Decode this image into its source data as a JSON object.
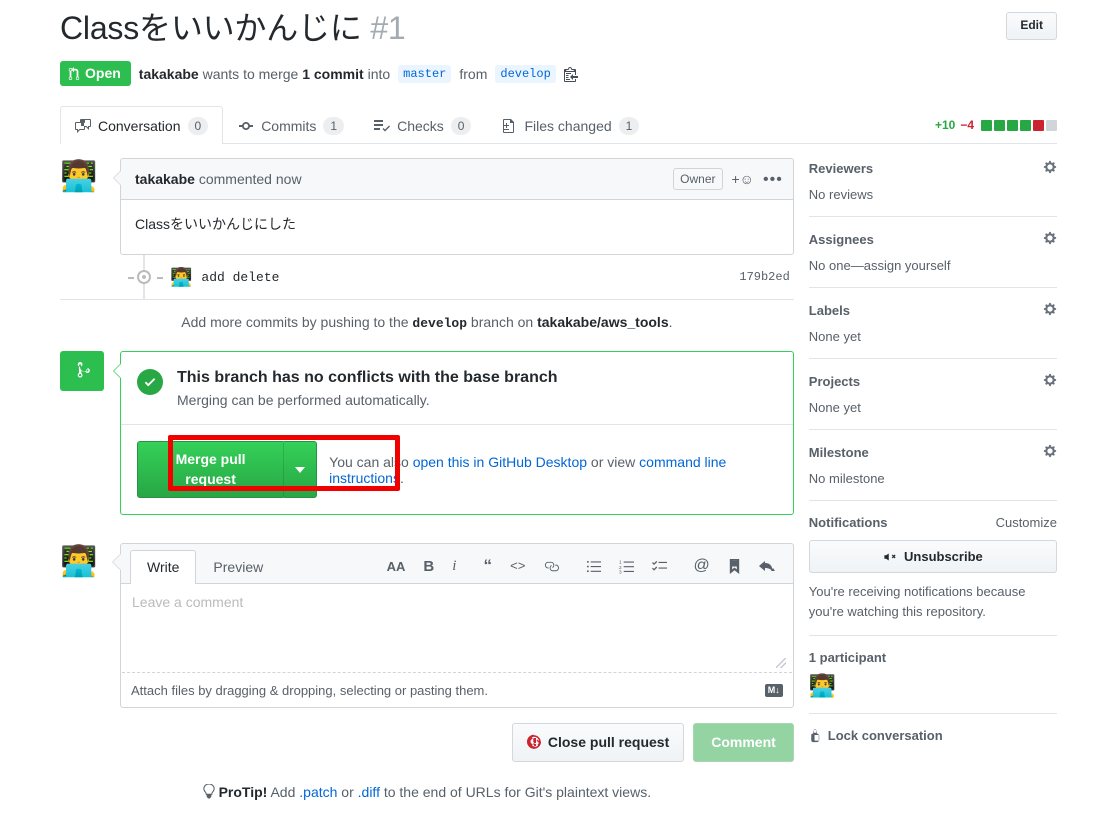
{
  "header": {
    "title": "Classをいいかんじに",
    "number": "#1",
    "edit_label": "Edit",
    "state": "Open",
    "author": "takakabe",
    "meta_prefix": "wants to merge",
    "commit_count_text": "1 commit",
    "meta_into": "into",
    "base_branch": "master",
    "meta_from": "from",
    "head_branch": "develop"
  },
  "tabs": [
    {
      "label": "Conversation",
      "count": "0",
      "icon": "comment-discussion-icon",
      "active": true
    },
    {
      "label": "Commits",
      "count": "1",
      "icon": "git-commit-icon",
      "active": false
    },
    {
      "label": "Checks",
      "count": "0",
      "icon": "checklist-icon",
      "active": false
    },
    {
      "label": "Files changed",
      "count": "1",
      "icon": "file-diff-icon",
      "active": false
    }
  ],
  "diffstat": {
    "additions": "+10",
    "deletions": "−4",
    "blocks": [
      "#28a745",
      "#28a745",
      "#28a745",
      "#28a745",
      "#cb2431",
      "#d1d5da"
    ]
  },
  "comment": {
    "author": "takakabe",
    "action": "commented",
    "time": "now",
    "owner_badge": "Owner",
    "body": "Classをいいかんじにした"
  },
  "commit": {
    "message": "add delete",
    "sha": "179b2ed"
  },
  "push_hint": {
    "pre": "Add more commits by pushing to the",
    "branch": "develop",
    "mid": "branch on",
    "repo": "takakabe/aws_tools",
    "post": "."
  },
  "merge": {
    "status_title": "This branch has no conflicts with the base branch",
    "status_sub": "Merging can be performed automatically.",
    "button_label": "Merge pull request",
    "help_pre": "You can also",
    "help_link1": "open this in GitHub Desktop",
    "help_mid": "or view",
    "help_link2": "command line instructions",
    "help_post": "."
  },
  "form": {
    "write_tab": "Write",
    "preview_tab": "Preview",
    "placeholder": "Leave a comment",
    "attach_hint": "Attach files by dragging & dropping, selecting or pasting them.",
    "markdown_badge": "M↓",
    "close_label": "Close pull request",
    "comment_label": "Comment",
    "toolbar": [
      {
        "name": "heading-icon",
        "glyph": "AA"
      },
      {
        "name": "bold-icon",
        "glyph": "B"
      },
      {
        "name": "italic-icon",
        "glyph": "i"
      },
      {
        "name": "quote-icon",
        "glyph": "“"
      },
      {
        "name": "code-icon",
        "glyph": "<>"
      },
      {
        "name": "link-icon",
        "glyph": "link"
      },
      {
        "name": "unordered-list-icon",
        "glyph": "list"
      },
      {
        "name": "ordered-list-icon",
        "glyph": "numlist"
      },
      {
        "name": "task-list-icon",
        "glyph": "tasklist"
      },
      {
        "name": "mention-icon",
        "glyph": "@"
      },
      {
        "name": "saved-reply-icon",
        "glyph": "bookmark"
      },
      {
        "name": "reply-icon",
        "glyph": "reply"
      }
    ]
  },
  "sidebar": {
    "reviewers": {
      "title": "Reviewers",
      "empty": "No reviews"
    },
    "assignees": {
      "title": "Assignees",
      "empty": "No one—assign yourself"
    },
    "labels": {
      "title": "Labels",
      "empty": "None yet"
    },
    "projects": {
      "title": "Projects",
      "empty": "None yet"
    },
    "milestone": {
      "title": "Milestone",
      "empty": "No milestone"
    },
    "notifications": {
      "title": "Notifications",
      "customize": "Customize",
      "button": "Unsubscribe",
      "note": "You're receiving notifications because you're watching this repository."
    },
    "participants": {
      "title": "1 participant"
    },
    "lock": {
      "label": "Lock conversation"
    }
  },
  "protip": {
    "label": "ProTip!",
    "pre": "Add",
    "link1": ".patch",
    "mid": "or",
    "link2": ".diff",
    "post": "to the end of URLs for Git's plaintext views."
  },
  "colors": {
    "open_green": "#2cbe4e",
    "merge_green": "#28a745",
    "link_blue": "#0366d6",
    "annotation_red": "#f10000"
  }
}
